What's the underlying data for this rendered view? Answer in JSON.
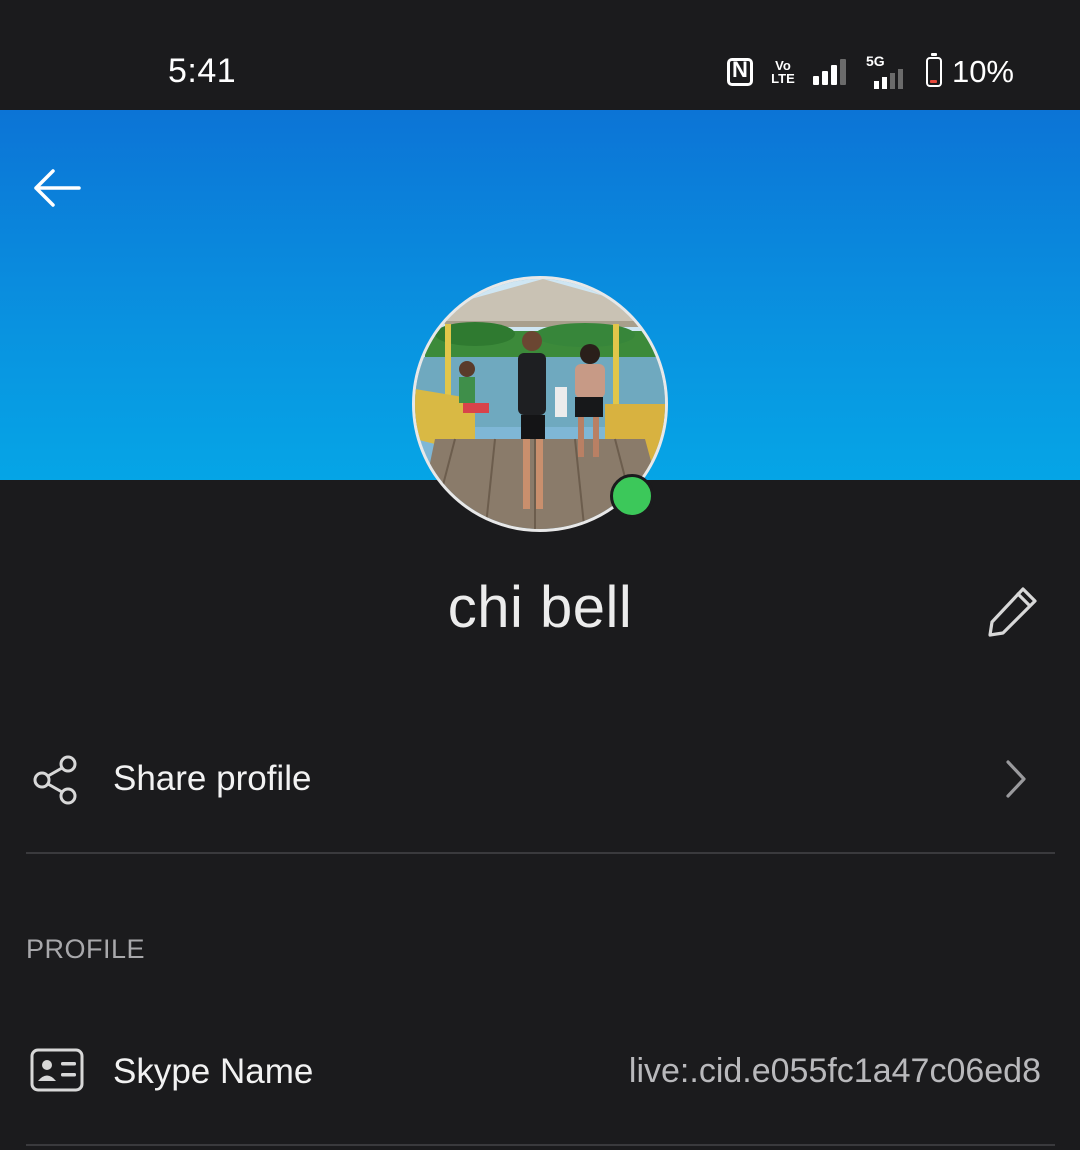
{
  "status_bar": {
    "time": "5:41",
    "network_label": "5G",
    "volte_label": "Vo LTE",
    "battery_percent": "10%"
  },
  "header": {
    "accent_color": "#0c8fe0"
  },
  "profile": {
    "display_name": "chi bell",
    "presence": "online",
    "presence_color": "#3cc85a"
  },
  "actions": {
    "share_profile_label": "Share profile"
  },
  "section": {
    "heading": "PROFILE"
  },
  "fields": {
    "skype_name_label": "Skype Name",
    "skype_name_value": "live:.cid.e055fc1a47c06ed8"
  }
}
